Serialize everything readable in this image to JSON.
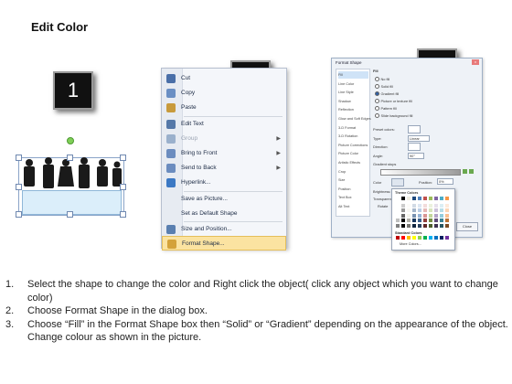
{
  "title": "Edit Color",
  "steps": [
    "1",
    "2",
    "3"
  ],
  "context_menu": {
    "items": [
      {
        "label": "Cut",
        "icon": "scissors-icon",
        "color": "#4a6fa8",
        "disabled": false,
        "arrow": false
      },
      {
        "label": "Copy",
        "icon": "copy-icon",
        "color": "#6a8fc4",
        "disabled": false,
        "arrow": false
      },
      {
        "label": "Paste",
        "icon": "paste-icon",
        "color": "#c89a3c",
        "disabled": false,
        "arrow": false
      },
      {
        "label": "Edit Text",
        "icon": "edit-text-icon",
        "color": "#5578a8",
        "disabled": false,
        "arrow": false
      },
      {
        "label": "Group",
        "icon": "group-icon",
        "color": "#9ab0cc",
        "disabled": true,
        "arrow": true
      },
      {
        "label": "Bring to Front",
        "icon": "bring-to-front-icon",
        "color": "#6b8cbf",
        "disabled": false,
        "arrow": true
      },
      {
        "label": "Send to Back",
        "icon": "send-to-back-icon",
        "color": "#6b8cbf",
        "disabled": false,
        "arrow": true
      },
      {
        "label": "Hyperlink...",
        "icon": "hyperlink-icon",
        "color": "#3b78c4",
        "disabled": false,
        "arrow": false
      },
      {
        "label": "Save as Picture...",
        "icon": "",
        "color": "",
        "disabled": false,
        "arrow": false
      },
      {
        "label": "Set as Default Shape",
        "icon": "",
        "color": "",
        "disabled": false,
        "arrow": false
      },
      {
        "label": "Size and Position...",
        "icon": "size-position-icon",
        "color": "#5a7fb0",
        "disabled": false,
        "arrow": false
      },
      {
        "label": "Format Shape...",
        "icon": "format-shape-icon",
        "color": "#d4a23a",
        "disabled": false,
        "arrow": false,
        "highlight": true
      }
    ]
  },
  "dialog": {
    "title": "Format Shape",
    "close_glyph": "x",
    "nav": [
      "Fill",
      "Line Color",
      "Line Style",
      "Shadow",
      "Reflection",
      "Glow and Soft Edges",
      "3-D Format",
      "3-D Rotation",
      "Picture Corrections",
      "Picture Color",
      "Artistic Effects",
      "Crop",
      "Size",
      "Position",
      "Text Box",
      "Alt Text"
    ],
    "heading": "Fill",
    "fill_options": [
      "No fill",
      "Solid fill",
      "Gradient fill",
      "Picture or texture fill",
      "Pattern fill",
      "Slide background fill"
    ],
    "preset_label": "Preset colors:",
    "type_label": "Type:",
    "type_value": "Linear",
    "direction_label": "Direction:",
    "angle_label": "Angle:",
    "angle_value": "90°",
    "stops_label": "Gradient stops",
    "color_label": "Color",
    "position_label": "Position:",
    "position_value": "0%",
    "brightness_label": "Brightness:",
    "transparency_label": "Transparency:",
    "rotate_label": "Rotate",
    "close_button": "Close"
  },
  "palette": {
    "theme_label": "Theme Colors",
    "standard_label": "Standard Colors",
    "more_label": "More Colors...",
    "theme_colors": [
      "#ffffff",
      "#000000",
      "#eeece1",
      "#1f497d",
      "#4f81bd",
      "#c0504d",
      "#9bbb59",
      "#8064a2",
      "#4bacc6",
      "#f79646"
    ],
    "standard_colors": [
      "#c00000",
      "#ff0000",
      "#ffc000",
      "#ffff00",
      "#92d050",
      "#00b050",
      "#00b0f0",
      "#0070c0",
      "#002060",
      "#7030a0"
    ]
  },
  "instructions": [
    {
      "num": "1.",
      "text": "Select the shape to change the color and Right click the object( click any object which you want to change color)"
    },
    {
      "num": "2.",
      "text": "Choose Format Shape in the dialog box."
    },
    {
      "num": "3.",
      "text": "Choose “Fill” in the Format Shape box then “Solid” or “Gradient” depending on the appearance of the object. Change colour as shown in the picture."
    }
  ]
}
